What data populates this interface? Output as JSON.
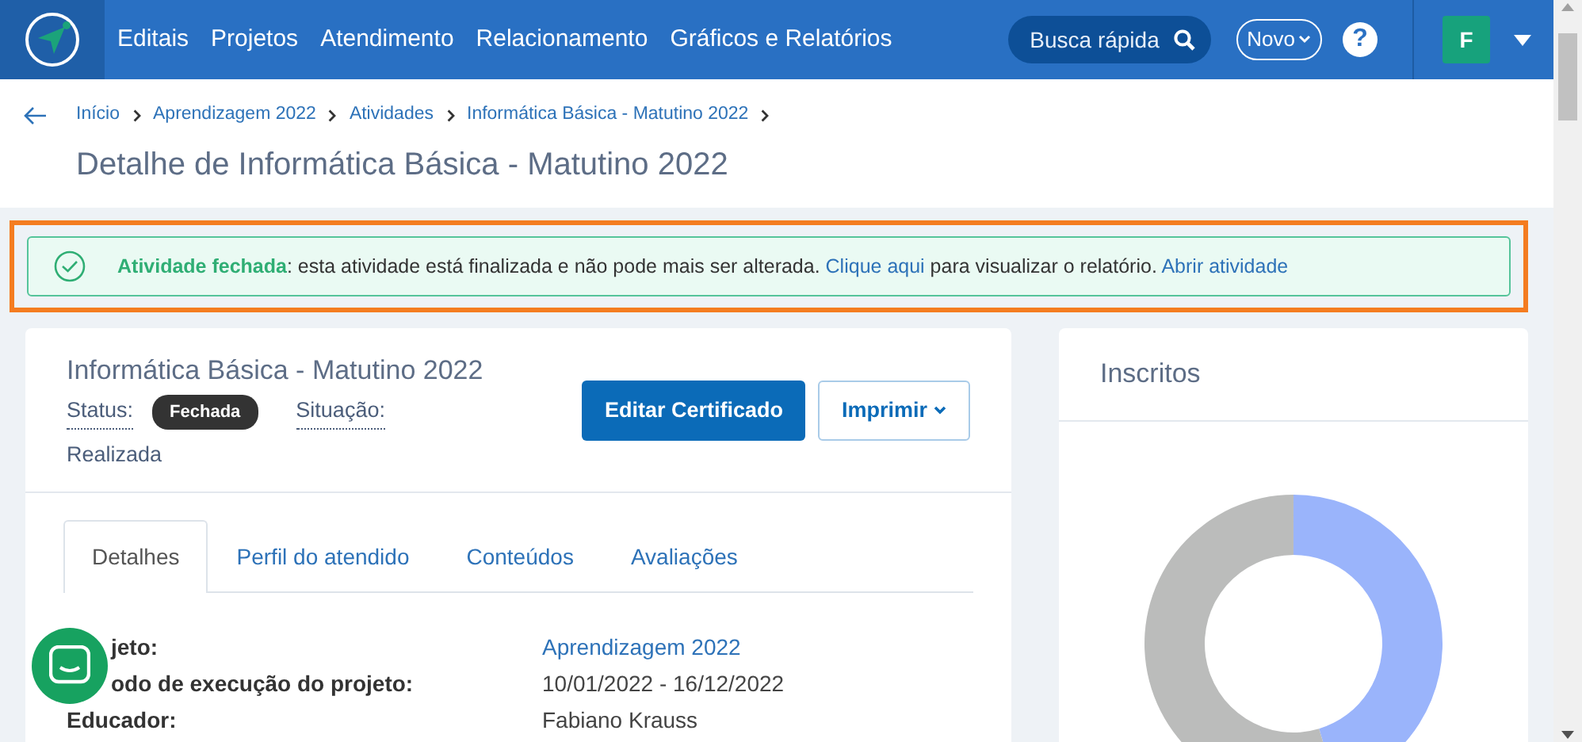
{
  "navbar": {
    "menu": [
      "Editais",
      "Projetos",
      "Atendimento",
      "Relacionamento",
      "Gráficos e Relatórios"
    ],
    "search": {
      "placeholder": "Busca rápida"
    },
    "new_button": "Novo",
    "help": "?",
    "avatar": "F"
  },
  "breadcrumb": [
    "Início",
    "Aprendizagem 2022",
    "Atividades",
    "Informática Básica - Matutino 2022"
  ],
  "page_title": "Detalhe de Informática Básica - Matutino 2022",
  "alert": {
    "title": "Atividade fechada",
    "text": ": esta atividade está finalizada e não pode mais ser alterada. ",
    "link_1": "Clique aqui",
    "text_2": " para visualizar o relatório. ",
    "link_2": "Abrir atividade"
  },
  "activity": {
    "title": "Informática Básica - Matutino 2022",
    "status_label": "Status:",
    "status": "Fechada",
    "situation_label": "Situação:",
    "situation": "Realizada",
    "buttons": [
      {
        "label": "Editar Certificado",
        "kind": "primary"
      },
      {
        "label": "Imprimir",
        "kind": "dropdown"
      }
    ]
  },
  "tabs": [
    {
      "label": "Detalhes",
      "selected": true
    },
    {
      "label": "Perfil do atendido",
      "selected": false
    },
    {
      "label": "Conteúdos",
      "selected": false
    },
    {
      "label": "Avaliações",
      "selected": false
    }
  ],
  "details": [
    {
      "label": "jeto:",
      "value": "Aprendizagem 2022",
      "link": true,
      "covered": true
    },
    {
      "label": "odo de execução do projeto:",
      "value": "10/01/2022 - 16/12/2022",
      "link": false,
      "covered": true
    },
    {
      "label": "Educador:",
      "value": "Fabiano Krauss",
      "link": false,
      "covered": false
    }
  ],
  "enrolled": {
    "title": "Inscritos"
  }
}
